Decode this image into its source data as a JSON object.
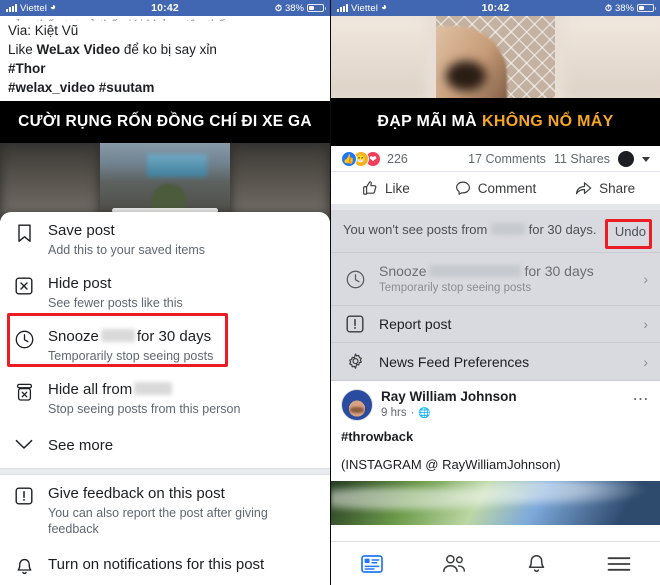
{
  "status_bar": {
    "carrier": "Viettel",
    "wifi_icon": "wifi-icon",
    "time": "10:42",
    "battery_percent": "38%",
    "battery_icon": "battery-icon",
    "signal_icon": "signal-bars-icon",
    "alarm_icon": "alarm-icon"
  },
  "left_panel": {
    "post_text": {
      "cut_line": "cảm thấy tụt cả thế giới khủng tận thế",
      "line_via": "Via: Kiệt Vũ",
      "line_like_prefix": "Like ",
      "line_like_bold": "WeLax Video",
      "line_like_suffix": " để ko bị say xỉn",
      "hashtag_1": "#Thor",
      "hashtag_2": "#welax_video #suutam"
    },
    "video_banner": "CƯỜI RỤNG RỐN ĐỒNG CHÍ ĐI XE GA",
    "menu": [
      {
        "icon": "bookmark-icon",
        "title": "Save post",
        "subtitle": "Add this to your saved items",
        "redacted": false,
        "highlighted": false
      },
      {
        "icon": "hide-post-icon",
        "title": "Hide post",
        "subtitle": "See fewer posts like this",
        "redacted": false,
        "highlighted": false
      },
      {
        "icon": "clock-icon",
        "title_before": "Snooze",
        "title_after": "for 30 days",
        "subtitle": "Temporarily stop seeing posts",
        "redacted": true,
        "highlighted": true
      },
      {
        "icon": "hide-all-icon",
        "title_before": "Hide all from",
        "title_after": "",
        "subtitle": "Stop seeing posts from this person",
        "redacted": true,
        "highlighted": false
      },
      {
        "icon": "chevron-down-icon",
        "title": "See more",
        "subtitle": "",
        "redacted": false,
        "highlighted": false
      }
    ],
    "menu_section_2": [
      {
        "icon": "report-icon",
        "title": "Give feedback on this post",
        "subtitle": "You can also report the post after giving feedback"
      },
      {
        "icon": "bell-icon",
        "title": "Turn on notifications for this post",
        "subtitle": ""
      }
    ],
    "highlight_color": "#ec1c24"
  },
  "right_panel": {
    "video_banner_white": "ĐẠP MÃI MÀ",
    "video_banner_yellow": "KHÔNG NỔ MÁY",
    "engagement": {
      "reaction_count": "226",
      "comments": "17 Comments",
      "shares": "11 Shares",
      "reactions": [
        "like-icon",
        "haha-icon",
        "love-icon"
      ],
      "caret_icon": "chevron-down-icon",
      "avatar": "avatar"
    },
    "actions": [
      {
        "icon": "thumbs-up-icon",
        "label": "Like"
      },
      {
        "icon": "comment-icon",
        "label": "Comment"
      },
      {
        "icon": "share-icon",
        "label": "Share"
      }
    ],
    "notice": {
      "text_before": "You won't see posts from",
      "text_after": "for 30 days.",
      "undo_label": "Undo"
    },
    "menu": [
      {
        "icon": "clock-icon",
        "title_before": "Snooze",
        "title_after": "for 30 days",
        "subtitle": "Temporarily stop seeing posts",
        "redacted": true,
        "disabled": true,
        "chevron": "›"
      },
      {
        "icon": "report-icon",
        "title_before": "Report post",
        "title_after": "",
        "subtitle": "",
        "redacted": false,
        "disabled": false,
        "chevron": "›"
      },
      {
        "icon": "gear-icon",
        "title_before": "News Feed Preferences",
        "title_after": "",
        "subtitle": "",
        "redacted": false,
        "disabled": false,
        "chevron": "›"
      }
    ],
    "post": {
      "author": "Ray William Johnson",
      "time": "9 hrs",
      "separator": "·",
      "privacy_icon": "globe-icon",
      "more_icon": "more-options-icon",
      "body_line_1": "#throwback",
      "body_line_2": "(INSTAGRAM @ RayWilliamJohnson)"
    },
    "tabbar": [
      {
        "icon": "news-feed-icon",
        "active": true
      },
      {
        "icon": "friends-icon",
        "active": false
      },
      {
        "icon": "notifications-bell-icon",
        "active": false
      },
      {
        "icon": "menu-hamburger-icon",
        "active": false
      }
    ],
    "highlight_color": "#ec1c24"
  }
}
